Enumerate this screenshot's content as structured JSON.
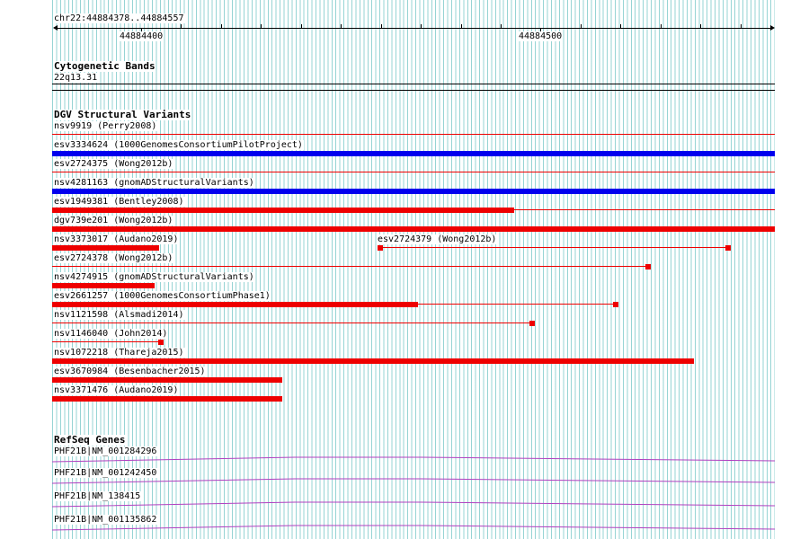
{
  "ruler": {
    "region": "chr22:44884378..44884557",
    "label_left": "44884400",
    "label_right": "44884500"
  },
  "cytoband": {
    "title": "Cytogenetic Bands",
    "band": "22q13.31"
  },
  "dgv": {
    "title": "DGV Structural Variants",
    "labels": [
      "nsv9919 (Perry2008)",
      "esv3334624 (1000GenomesConsortiumPilotProject)",
      "esv2724375 (Wong2012b)",
      "nsv4281163 (gnomADStructuralVariants)",
      "esv1949381 (Bentley2008)",
      "dgv739e201 (Wong2012b)",
      "nsv3373017 (Audano2019)",
      "esv2724379 (Wong2012b)",
      "esv2724378 (Wong2012b)",
      "nsv4274915 (gnomADStructuralVariants)",
      "esv2661257 (1000GenomesConsortiumPhase1)",
      "nsv1121598 (Alsmadi2014)",
      "nsv1146040 (John2014)",
      "nsv1072218 (Thareja2015)",
      "esv3670984 (Besenbacher2015)",
      "nsv3371476 (Audano2019)"
    ]
  },
  "refseq": {
    "title": "RefSeq Genes",
    "labels": [
      "PHF21B|NM_001284296",
      "PHF21B|NM_001242450",
      "PHF21B|NM_138415",
      "PHF21B|NM_001135862"
    ]
  },
  "colors": {
    "gain": "#0000ee",
    "loss": "#ee0000",
    "gene": "#b040c0",
    "grid": "#40b0b0"
  }
}
